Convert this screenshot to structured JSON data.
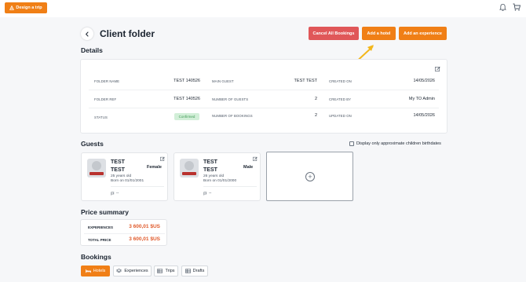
{
  "topbar": {
    "design_label": "Design a trip"
  },
  "header": {
    "title": "Client folder",
    "cancel_label": "Cancel All Bookings",
    "add_hotel_label": "Add a hotel",
    "add_experience_label": "Add an experience"
  },
  "details": {
    "title": "Details",
    "folder_name_label": "FOLDER NAME",
    "folder_name": "TEST 140526",
    "folder_ref_label": "FOLDER REF",
    "folder_ref": "TEST 140526",
    "status_label": "STATUS",
    "status": "Confirmed",
    "main_guest_label": "MAIN GUEST",
    "main_guest": "TEST TEST",
    "num_guests_label": "NUMBER OF GUESTS",
    "num_guests": "2",
    "num_bookings_label": "NUMBER OF BOOKINGS",
    "num_bookings": "2",
    "created_on_label": "CREATED ON",
    "created_on": "14/05/2026",
    "created_by_label": "CREATED BY",
    "created_by": "My TO Admin",
    "updated_on_label": "UPDATED ON",
    "updated_on": "14/05/2026"
  },
  "guests": {
    "title": "Guests",
    "approx_label": "Display only approximate children birthdates",
    "items": [
      {
        "first": "TEST",
        "last": "TEST",
        "gender": "Female",
        "age": "25 years old",
        "born": "Born on 01/01/2001",
        "nationality": "--"
      },
      {
        "first": "TEST",
        "last": "TEST",
        "gender": "Male",
        "age": "26 years old",
        "born": "Born on 01/01/2000",
        "nationality": "--"
      }
    ]
  },
  "price": {
    "title": "Price summary",
    "experiences_label": "EXPERIENCES",
    "experiences": "3 600,01 $US",
    "total_label": "TOTAL PRICE",
    "total": "3 600,01 $US"
  },
  "bookings": {
    "title": "Bookings",
    "tabs": [
      {
        "label": "Hotels"
      },
      {
        "label": "Experiences"
      },
      {
        "label": "Trips"
      },
      {
        "label": "Drafts"
      }
    ]
  },
  "colors": {
    "accent": "#f07f16",
    "danger": "#e05759",
    "success_bg": "#d2efd8",
    "price": "#e05a2b"
  }
}
